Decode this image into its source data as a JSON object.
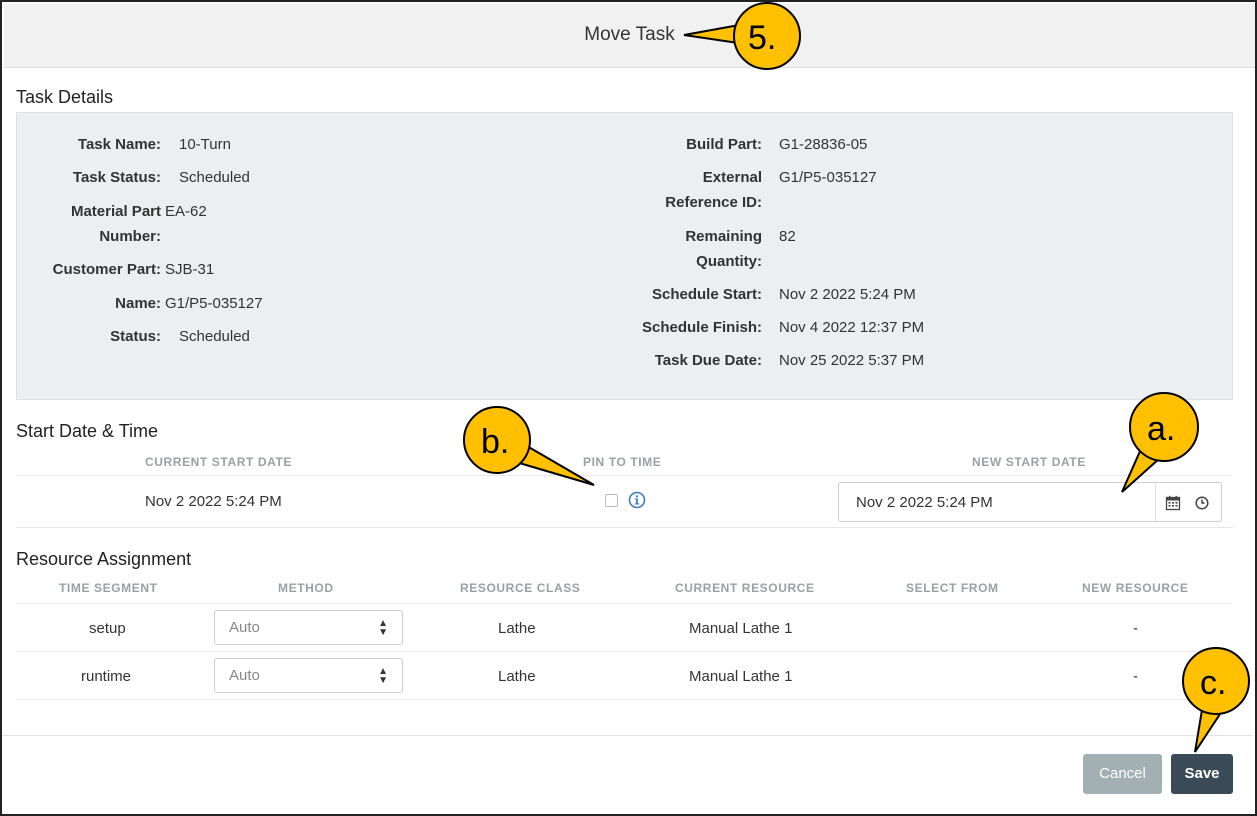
{
  "dialog": {
    "title": "Move Task"
  },
  "task_details": {
    "section_title": "Task Details",
    "left": [
      {
        "label": "Task Name:",
        "value": "10-Turn"
      },
      {
        "label": "Task Status:",
        "value": "Scheduled"
      },
      {
        "label_line1": "Material Part",
        "label_line2": "Number:",
        "value": "EA-62"
      },
      {
        "label": "Customer Part:",
        "value": "SJB-31"
      },
      {
        "label": "Name:",
        "value": "G1/P5-035127"
      },
      {
        "label": "Status:",
        "value": "Scheduled"
      }
    ],
    "right": [
      {
        "label": "Build Part:",
        "value": "G1-28836-05"
      },
      {
        "label_line1": "External",
        "label_line2": "Reference ID:",
        "value": "G1/P5-035127"
      },
      {
        "label_line1": "Remaining",
        "label_line2": "Quantity:",
        "value": "82"
      },
      {
        "label": "Schedule Start:",
        "value": "Nov 2 2022 5:24 PM"
      },
      {
        "label": "Schedule Finish:",
        "value": "Nov 4 2022 12:37 PM"
      },
      {
        "label": "Task Due Date:",
        "value": "Nov 25 2022 5:37 PM"
      }
    ]
  },
  "start_date": {
    "section_title": "Start Date & Time",
    "headers": {
      "current": "CURRENT START DATE",
      "pin": "PIN TO TIME",
      "new": "NEW START DATE"
    },
    "current_value": "Nov 2 2022 5:24 PM",
    "pin_checked": false,
    "new_value": "Nov 2 2022 5:24 PM"
  },
  "resource_assignment": {
    "section_title": "Resource Assignment",
    "headers": [
      "TIME SEGMENT",
      "METHOD",
      "RESOURCE CLASS",
      "CURRENT RESOURCE",
      "SELECT FROM",
      "NEW RESOURCE"
    ],
    "rows": [
      {
        "segment": "setup",
        "method": "Auto",
        "resource_class": "Lathe",
        "current_resource": "Manual Lathe 1",
        "new_resource": "-"
      },
      {
        "segment": "runtime",
        "method": "Auto",
        "resource_class": "Lathe",
        "current_resource": "Manual Lathe 1",
        "new_resource": "-"
      }
    ]
  },
  "footer": {
    "cancel_label": "Cancel",
    "save_label": "Save"
  },
  "annotations": {
    "a": "a.",
    "b": "b.",
    "c": "c.",
    "step": "5."
  },
  "colors": {
    "callout_fill": "#ffc000",
    "save": "#3b4a57",
    "cancel": "#a2b0b3",
    "info": "#3f7fc0"
  },
  "icons": [
    "info-icon",
    "calendar-icon",
    "clock-icon",
    "select-caret-icon"
  ]
}
